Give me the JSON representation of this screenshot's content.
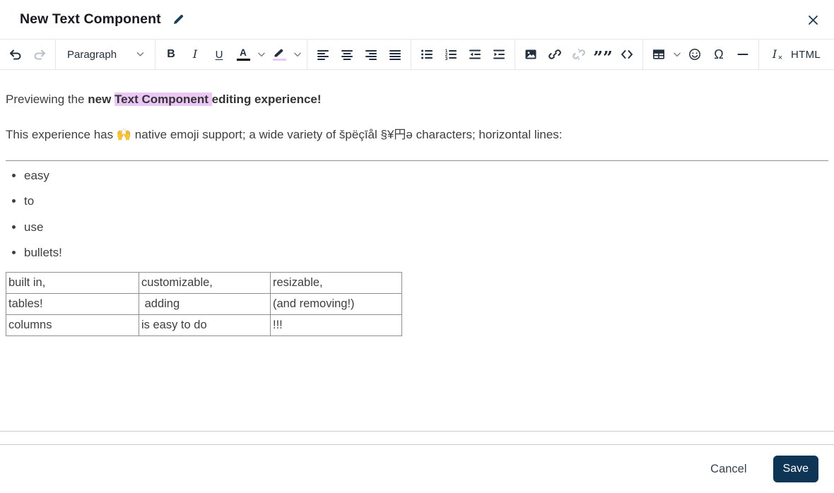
{
  "header": {
    "title": "New Text Component"
  },
  "toolbar": {
    "paragraph_label": "Paragraph",
    "bold_label": "B",
    "italic_label": "I",
    "underline_label": "U",
    "text_color_label": "A",
    "blockquote_label": "”",
    "omega_label": "Ω",
    "clear_format_label": "I",
    "clear_format_x": "×",
    "html_label": "HTML"
  },
  "content": {
    "p1": {
      "prefix": "Previewing the ",
      "bold_new": "new ",
      "highlighted": "Text Component ",
      "bold_rest": "editing experience!"
    },
    "p2": {
      "before_emoji": "This experience has ",
      "emoji": "🙌",
      "after_emoji": " native emoji support; a wide variety of špëçīål §¥円ǝ characters; horizontal lines:"
    },
    "bullets": [
      "easy",
      "to",
      "use",
      "bullets!"
    ],
    "table": {
      "rows": [
        [
          "built in,",
          "customizable,",
          "resizable,"
        ],
        [
          "tables!",
          " adding",
          "(and removing!)"
        ],
        [
          "columns",
          "is easy to do",
          "!!!"
        ]
      ]
    }
  },
  "footer": {
    "cancel_label": "Cancel",
    "save_label": "Save"
  },
  "colors": {
    "accent": "#0e3556",
    "highlight": "#ebc7f5",
    "icon": "#222f3e",
    "icon_disabled": "#b9c0c9",
    "border": "#e3e6ea"
  }
}
